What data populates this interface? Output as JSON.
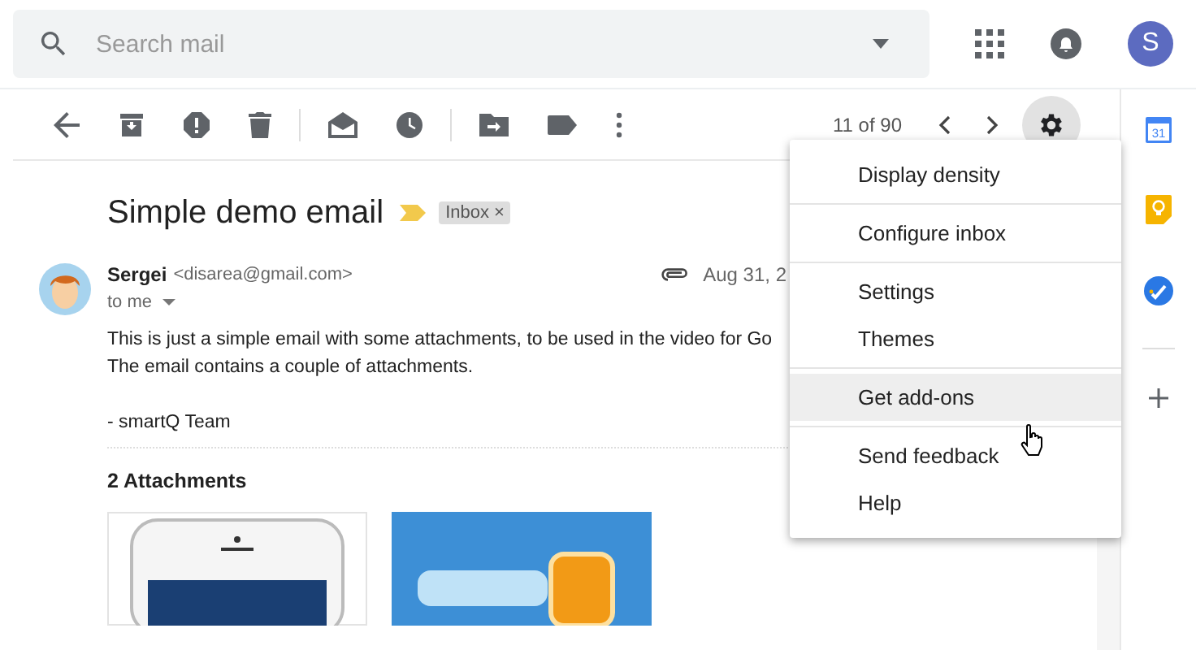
{
  "search": {
    "placeholder": "Search mail"
  },
  "account": {
    "initial": "S"
  },
  "toolbar": {
    "pager": "11 of 90"
  },
  "message": {
    "subject": "Simple demo email",
    "important": true,
    "labels": [
      {
        "text": "Inbox",
        "close": "×"
      }
    ],
    "sender": {
      "name": "Sergei",
      "email": "<disarea@gmail.com>"
    },
    "recipient": "to me",
    "date": "Aug 31, 2",
    "has_attachment": true,
    "body": [
      [
        "This is just a simple email with some attachments, to be used in the video for Go",
        "The email contains a couple of attachments."
      ],
      [
        "- smartQ Team"
      ]
    ],
    "attachments_title": "2 Attachments",
    "attachments": [
      {
        "kind": "phone"
      },
      {
        "kind": "logo"
      }
    ]
  },
  "settings_menu": {
    "open": true,
    "groups": [
      [
        {
          "label": "Display density",
          "selected": false
        }
      ],
      [
        {
          "label": "Configure inbox",
          "selected": false
        }
      ],
      [
        {
          "label": "Settings",
          "selected": false
        },
        {
          "label": "Themes",
          "selected": false
        }
      ],
      [
        {
          "label": "Get add-ons",
          "selected": true
        }
      ],
      [
        {
          "label": "Send feedback",
          "selected": false
        },
        {
          "label": "Help",
          "selected": false
        }
      ]
    ]
  },
  "side_rail": {
    "calendar_day": "31"
  }
}
